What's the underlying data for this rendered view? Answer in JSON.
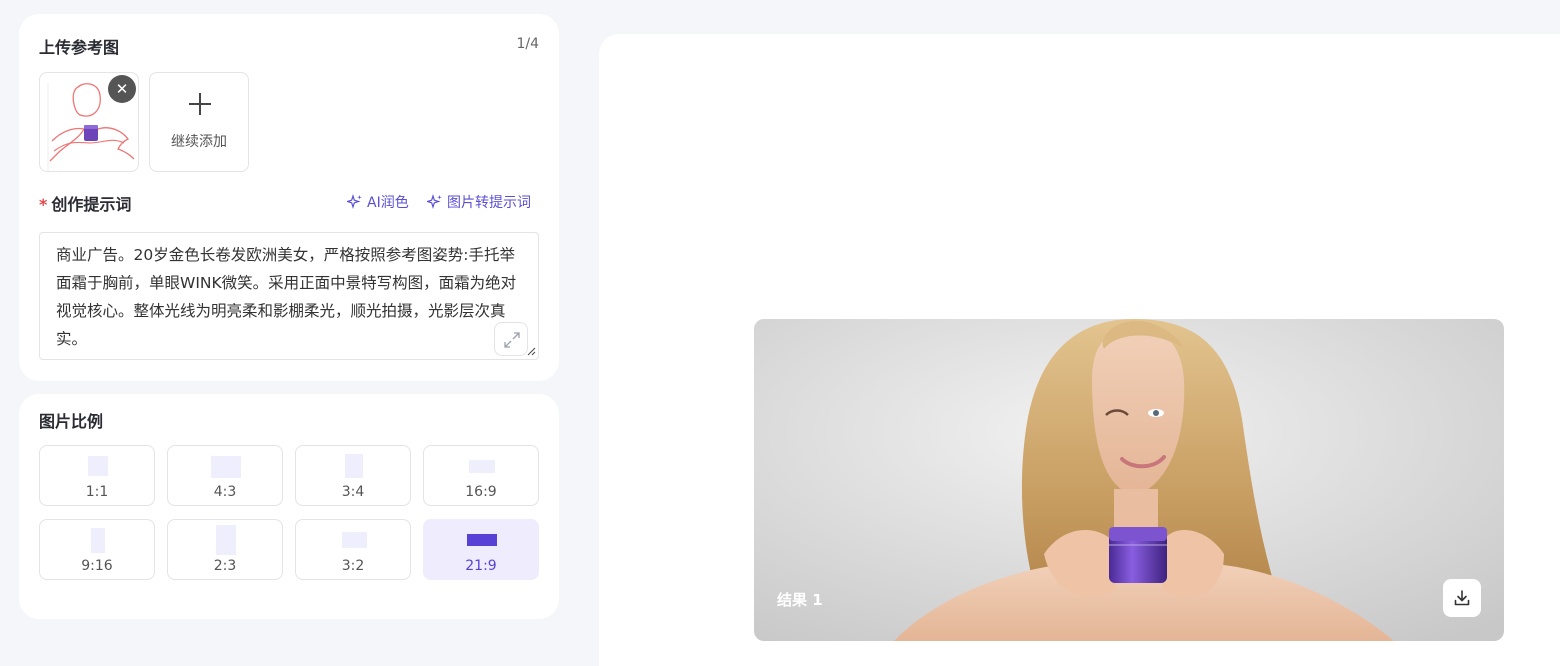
{
  "upload": {
    "title": "上传参考图",
    "count": "1/4",
    "remove_icon": "close-icon",
    "add_label": "继续添加",
    "add_icon": "plus-icon"
  },
  "prompt": {
    "required_mark": "*",
    "label": "创作提示词",
    "ai_polish": "AI润色",
    "image_to_prompt": "图片转提示词",
    "text": "商业广告。20岁金色长卷发欧洲美女，严格按照参考图姿势:手托举面霜于胸前，单眼WINK微笑。采用正面中景特写构图，面霜为绝对视觉核心。整体光线为明亮柔和影棚柔光，顺光拍摄，光影层次真实。",
    "expand_icon": "expand-icon"
  },
  "ratio": {
    "title": "图片比例",
    "options": [
      {
        "label": "1:1"
      },
      {
        "label": "4:3"
      },
      {
        "label": "3:4"
      },
      {
        "label": "16:9"
      },
      {
        "label": "9:16"
      },
      {
        "label": "2:3"
      },
      {
        "label": "3:2"
      },
      {
        "label": "21:9"
      }
    ],
    "selected": "21:9"
  },
  "result": {
    "label": "结果 1",
    "download_icon": "download-icon"
  },
  "colors": {
    "accent": "#5842d6",
    "accent_light": "#eeecfd",
    "required": "#e5484d",
    "background": "#f5f6fa"
  }
}
